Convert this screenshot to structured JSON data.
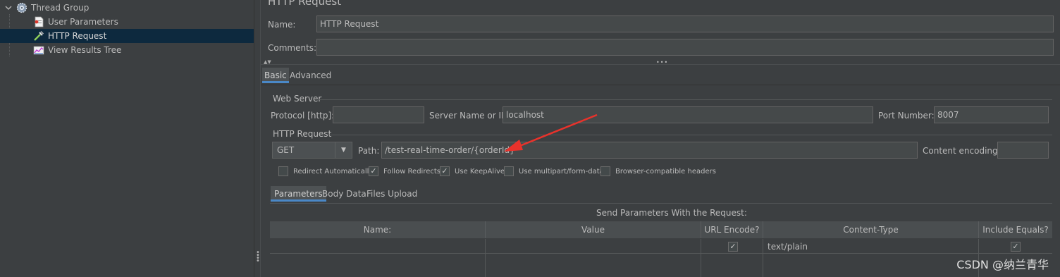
{
  "tree": {
    "items": [
      {
        "label": "Thread Group",
        "icon": "gear-icon"
      },
      {
        "label": "User Parameters",
        "icon": "document-icon"
      },
      {
        "label": "HTTP Request",
        "icon": "pipette-icon"
      },
      {
        "label": "View Results Tree",
        "icon": "chart-icon"
      }
    ]
  },
  "panel": {
    "title": "HTTP Request",
    "name_label": "Name:",
    "name_value": "HTTP Request",
    "comments_label": "Comments:",
    "comments_value": ""
  },
  "tabs": {
    "basic": "Basic",
    "advanced": "Advanced"
  },
  "web_server": {
    "group_label": "Web Server",
    "protocol_label": "Protocol [http]:",
    "protocol_value": "",
    "server_label": "Server Name or IP:",
    "server_value": "localhost",
    "port_label": "Port Number:",
    "port_value": "8007"
  },
  "http_request": {
    "group_label": "HTTP Request",
    "method": "GET",
    "path_label": "Path:",
    "path_value": "/test-real-time-order/{orderId}",
    "encoding_label": "Content encoding:",
    "encoding_value": ""
  },
  "options": [
    {
      "label": "Redirect Automatically",
      "checked": false
    },
    {
      "label": "Follow Redirects",
      "checked": true
    },
    {
      "label": "Use KeepAlive",
      "checked": true
    },
    {
      "label": "Use multipart/form-data",
      "checked": false
    },
    {
      "label": "Browser-compatible headers",
      "checked": false
    }
  ],
  "sub_tabs": {
    "parameters": "Parameters",
    "body_data": "Body Data",
    "files_upload": "Files Upload"
  },
  "params_table": {
    "caption": "Send Parameters With the Request:",
    "headers": [
      "Name:",
      "Value",
      "URL Encode?",
      "Content-Type",
      "Include Equals?"
    ],
    "rows": [
      {
        "name": "",
        "value": "",
        "url_encode": true,
        "content_type": "text/plain",
        "include_equals": true
      }
    ]
  },
  "watermark": "CSDN @纳兰青华",
  "colors": {
    "background": "#3c3f41",
    "selection": "#0d293e",
    "accent": "#4a88c7",
    "annotation_arrow": "#e8322b"
  }
}
